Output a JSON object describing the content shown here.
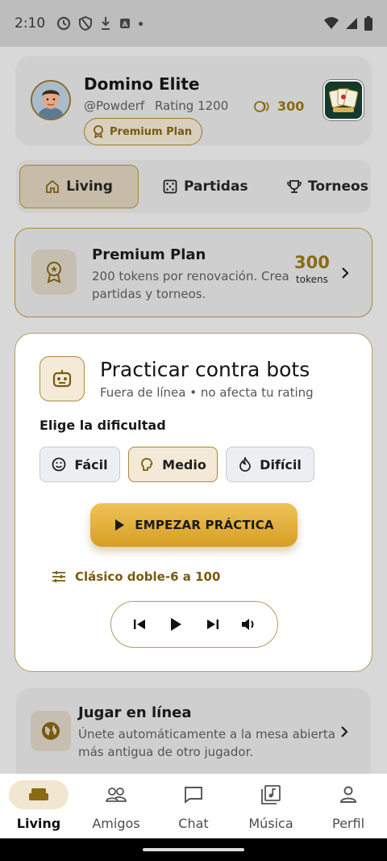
{
  "status_bar": {
    "time": "2:10"
  },
  "profile": {
    "name": "Domino Elite",
    "handle": "@Powderf",
    "rating": "Rating 1200",
    "plan": "Premium Plan",
    "tokens": "300"
  },
  "tabs": [
    {
      "label": "Living",
      "icon": "home-icon"
    },
    {
      "label": "Partidas",
      "icon": "dice-icon"
    },
    {
      "label": "Torneos",
      "icon": "trophy-icon"
    }
  ],
  "premium": {
    "title": "Premium Plan",
    "description": "200 tokens por renovación. Crea partidas y torneos.",
    "tokens_value": "300",
    "tokens_label": "tokens"
  },
  "practice": {
    "title": "Practicar contra bots",
    "subtitle": "Fuera de línea • no afecta tu rating",
    "difficulty_label": "Elige la dificultad",
    "difficulties": [
      {
        "label": "Fácil",
        "icon": "smile-icon",
        "selected": false
      },
      {
        "label": "Medio",
        "icon": "brain-icon",
        "selected": true
      },
      {
        "label": "Difícil",
        "icon": "flame-icon",
        "selected": false
      }
    ],
    "start_button": "EMPEZAR PRÁCTICA",
    "mode": "Clásico doble-6 a 100"
  },
  "online": {
    "title": "Jugar en línea",
    "description": "Únete automáticamente a la mesa abierta más antigua de otro jugador."
  },
  "bottom_nav": [
    {
      "label": "Living",
      "icon": "sofa-icon",
      "active": true
    },
    {
      "label": "Amigos",
      "icon": "people-icon",
      "active": false
    },
    {
      "label": "Chat",
      "icon": "chat-icon",
      "active": false
    },
    {
      "label": "Música",
      "icon": "music-icon",
      "active": false
    },
    {
      "label": "Perfil",
      "icon": "person-icon",
      "active": false
    }
  ],
  "colors": {
    "accent_gold": "#d79f23",
    "accent_brown": "#8a6a12",
    "card_bg": "#cfcfcf",
    "practice_bg": "#ffffff"
  }
}
